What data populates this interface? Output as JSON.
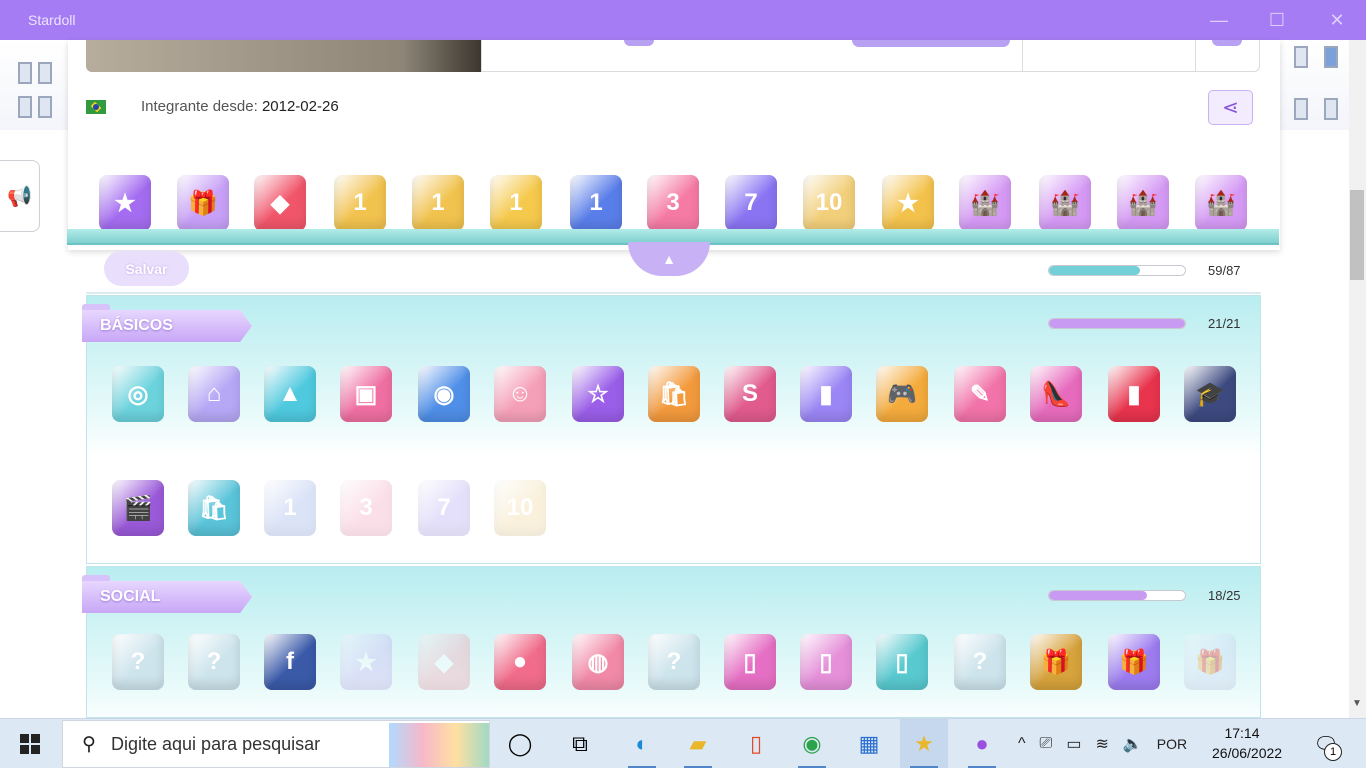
{
  "window": {
    "title": "Stardoll",
    "minimize": "—",
    "maximize": "☐",
    "close": "✕"
  },
  "profile": {
    "member_since_label": "Integrante desde:",
    "member_since_value": "2012-02-26",
    "share_icon": "share-icon",
    "save_label": "Salvar",
    "overall_progress_text": "59/87",
    "overall_progress_fraction": 0.67
  },
  "showcase_trophies": [
    {
      "icon": "phone-star",
      "color": "#a46cf0",
      "glyph": "★"
    },
    {
      "icon": "gift-gem",
      "color": "#c7a0f7",
      "glyph": "🎁"
    },
    {
      "icon": "red-crystal",
      "color": "#f1556a",
      "glyph": "◆"
    },
    {
      "icon": "gold-medal-1",
      "color": "#f1c24e",
      "glyph": "1"
    },
    {
      "icon": "gold-medal-1",
      "color": "#f1c24e",
      "glyph": "1"
    },
    {
      "icon": "gold-medal-1-large",
      "color": "#f5c94c",
      "glyph": "1"
    },
    {
      "icon": "blue-number-1",
      "color": "#5a7ee9",
      "glyph": "1"
    },
    {
      "icon": "pink-number-3",
      "color": "#f57aa4",
      "glyph": "3"
    },
    {
      "icon": "purple-number-7",
      "color": "#8a74f2",
      "glyph": "7"
    },
    {
      "icon": "gold-number-10",
      "color": "#f2cf7a",
      "glyph": "10"
    },
    {
      "icon": "gold-star",
      "color": "#f3c24c",
      "glyph": "★"
    },
    {
      "icon": "castle-small",
      "color": "#d59af5",
      "glyph": "🏰"
    },
    {
      "icon": "castle-medium",
      "color": "#d59af5",
      "glyph": "🏰"
    },
    {
      "icon": "castle-large",
      "color": "#d59af5",
      "glyph": "🏰"
    },
    {
      "icon": "castle-xlarge",
      "color": "#d59af5",
      "glyph": "🏰"
    }
  ],
  "sections": [
    {
      "label": "BÁSICOS",
      "progress_text": "21/21",
      "progress_fraction": 1.0,
      "row1": [
        {
          "icon": "mirror",
          "color": "#6cd3dd",
          "glyph": "◎",
          "faded": false
        },
        {
          "icon": "house-gem",
          "color": "#b6a8f5",
          "glyph": "⌂",
          "faded": false
        },
        {
          "icon": "blue-mountains",
          "color": "#4fc9de",
          "glyph": "▲",
          "faded": false
        },
        {
          "icon": "photo-frame",
          "color": "#ef6fa2",
          "glyph": "▣",
          "faded": false
        },
        {
          "icon": "camera",
          "color": "#4f8fe8",
          "glyph": "◉",
          "faded": false
        },
        {
          "icon": "profile-gem",
          "color": "#f5a0b9",
          "glyph": "☺",
          "faded": false
        },
        {
          "icon": "purple-star-gem",
          "color": "#9a5ee8",
          "glyph": "☆",
          "faded": false
        },
        {
          "icon": "shopping-gem",
          "color": "#f39a3d",
          "glyph": "🛍",
          "faded": false
        },
        {
          "icon": "starbazaar-gem",
          "color": "#e15b8d",
          "glyph": "S",
          "faded": false
        },
        {
          "icon": "crystal-tower",
          "color": "#9b86f5",
          "glyph": "▮",
          "faded": false
        },
        {
          "icon": "game-controller",
          "color": "#f4ab3c",
          "glyph": "🎮",
          "faded": false
        },
        {
          "icon": "quill-ink",
          "color": "#f173a9",
          "glyph": "✎",
          "faded": false
        },
        {
          "icon": "high-heel",
          "color": "#e76bbd",
          "glyph": "👠",
          "faded": false
        },
        {
          "icon": "nail-polish",
          "color": "#e8344d",
          "glyph": "▮",
          "faded": false
        },
        {
          "icon": "graduation-cap",
          "color": "#3d4a80",
          "glyph": "🎓",
          "faded": false
        }
      ],
      "row2": [
        {
          "icon": "clapperboard",
          "color": "#9a5ad9",
          "glyph": "🎬",
          "faded": false
        },
        {
          "icon": "shopping-bags",
          "color": "#5ac4d9",
          "glyph": "🛍",
          "faded": false
        },
        {
          "icon": "blue-number-1",
          "color": "#9ab0ea",
          "glyph": "1",
          "faded": true
        },
        {
          "icon": "pink-number-3",
          "color": "#f5a6c0",
          "glyph": "3",
          "faded": true
        },
        {
          "icon": "purple-number-7",
          "color": "#b3a6f2",
          "glyph": "7",
          "faded": true
        },
        {
          "icon": "gold-number-10",
          "color": "#f2d8a0",
          "glyph": "10",
          "faded": true
        }
      ]
    },
    {
      "label": "SOCIAL",
      "progress_text": "18/25",
      "progress_fraction": 0.72,
      "row1": [
        {
          "icon": "question-crystal",
          "color": "#cde4ec",
          "glyph": "?",
          "faded": false
        },
        {
          "icon": "question-crystal",
          "color": "#cde4ec",
          "glyph": "?",
          "faded": false
        },
        {
          "icon": "facebook-gem",
          "color": "#3a5aa8",
          "glyph": "f",
          "faded": false
        },
        {
          "icon": "phone-star",
          "color": "#c9b5f5",
          "glyph": "★",
          "faded": true
        },
        {
          "icon": "red-crystal",
          "color": "#f3a3b0",
          "glyph": "◆",
          "faded": true
        },
        {
          "icon": "cupcake",
          "color": "#f06c8a",
          "glyph": "●",
          "faded": false
        },
        {
          "icon": "cake",
          "color": "#f18aa8",
          "glyph": "◍",
          "faded": false
        },
        {
          "icon": "question-crystal",
          "color": "#cde4ec",
          "glyph": "?",
          "faded": false
        },
        {
          "icon": "pink-box",
          "color": "#e56fc4",
          "glyph": "▯",
          "faded": false
        },
        {
          "icon": "pink-boxes",
          "color": "#e590d9",
          "glyph": "▯",
          "faded": false
        },
        {
          "icon": "pink-teal-boxes",
          "color": "#58c9cf",
          "glyph": "▯",
          "faded": false
        },
        {
          "icon": "question-crystal",
          "color": "#cde4ec",
          "glyph": "?",
          "faded": false
        },
        {
          "icon": "gold-gift",
          "color": "#d6a33c",
          "glyph": "🎁",
          "faded": false
        },
        {
          "icon": "purple-gift",
          "color": "#9c7cf0",
          "glyph": "🎁",
          "faded": false
        },
        {
          "icon": "pale-gift",
          "color": "#cfd8f5",
          "glyph": "🎁",
          "faded": true
        }
      ]
    }
  ],
  "taskbar": {
    "search_placeholder": "Digite aqui para pesquisar",
    "apps": [
      "cortana-icon",
      "task-view-icon",
      "edge-icon",
      "file-explorer-icon",
      "office-icon",
      "chrome-icon",
      "store-icon",
      "stardoll-icon",
      "firefox-icon"
    ],
    "language": "POR",
    "time": "17:14",
    "date": "26/06/2022",
    "notification_count": "1"
  }
}
